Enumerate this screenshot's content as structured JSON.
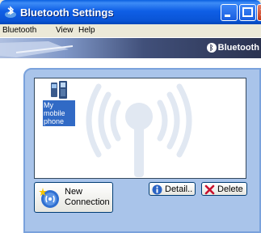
{
  "window": {
    "title": "Bluetooth Settings"
  },
  "menu": {
    "items": [
      "Bluetooth",
      "View",
      "Help"
    ]
  },
  "banner": {
    "brand": "Bluetooth"
  },
  "devices": [
    {
      "label_line1": "My mobile",
      "label_line2": "phone",
      "icon": "mobile-phone-icon"
    }
  ],
  "buttons": {
    "new_connection": {
      "line1": "New",
      "line2": "Connection",
      "icon": "new-connection-icon"
    },
    "detail": {
      "label": "Detail..",
      "icon": "info-icon"
    },
    "delete": {
      "label": "Delete",
      "icon": "delete-x-icon"
    }
  },
  "colors": {
    "titlebar": "#0a54d6",
    "selection": "#316ac5",
    "panel": "#a9c4ea",
    "delete_x": "#c8102e"
  }
}
